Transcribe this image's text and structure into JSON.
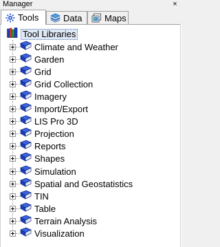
{
  "window": {
    "title": "Manager",
    "close_glyph": "×"
  },
  "tabs": [
    {
      "label": "Tools",
      "icon": "tools-icon",
      "active": true
    },
    {
      "label": "Data",
      "icon": "data-icon",
      "active": false
    },
    {
      "label": "Maps",
      "icon": "maps-icon",
      "active": false
    }
  ],
  "tree": {
    "root_label": "Tool Libraries",
    "items": [
      "Climate and Weather",
      "Garden",
      "Grid",
      "Grid Collection",
      "Imagery",
      "Import/Export",
      "LIS Pro 3D",
      "Projection",
      "Reports",
      "Shapes",
      "Simulation",
      "Spatial and Geostatistics",
      "TIN",
      "Table",
      "Terrain Analysis",
      "Visualization"
    ]
  },
  "colors": {
    "book_blue": "#1a3fbf",
    "selection_bg": "#dfe8f5"
  }
}
